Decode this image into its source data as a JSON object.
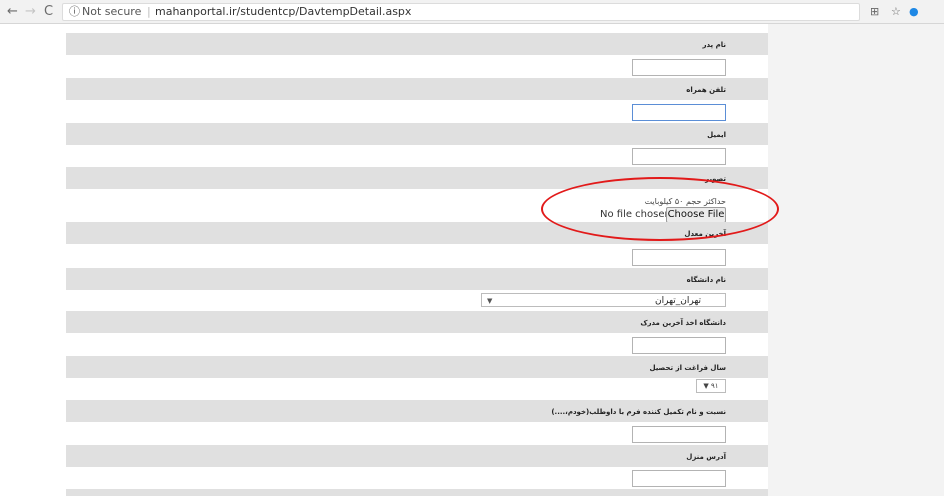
{
  "browser": {
    "security_label": "Not secure",
    "url": "mahanportal.ir/studentcp/DavtempDetail.aspx",
    "back_icon": "←",
    "forward_icon": "→",
    "reload_icon": "C",
    "info_icon": "ⓘ",
    "translate_icon": "⊞",
    "bookmark_icon": "☆",
    "extension_icon": "●"
  },
  "form": {
    "fields": [
      {
        "label": "نام پدر"
      },
      {
        "label": "تلفن همراه"
      },
      {
        "label": "ایمیل"
      },
      {
        "label": "تصویر"
      },
      {
        "label": "آخرین معدل"
      },
      {
        "label": "نام دانشگاه"
      },
      {
        "label": "دانشگاه اخذ آخرین مدرک"
      },
      {
        "label": "سال فراغت از تحصیل"
      },
      {
        "label": "نسبت و نام تکمیل کننده فرم با داوطلب(خودم،....)"
      },
      {
        "label": "آدرس منزل"
      }
    ],
    "photo": {
      "hint": "حداکثر حجم ۵۰ کیلوبایت",
      "no_file": "No file chosen",
      "choose_button": "Choose File"
    },
    "university_select": {
      "value": "تهران_تهران",
      "arrow": "▼"
    },
    "year_select": {
      "value": "▼ ۹۱"
    }
  },
  "annotation": {
    "color": "#e21a1a",
    "shape": "ellipse-highlight"
  }
}
